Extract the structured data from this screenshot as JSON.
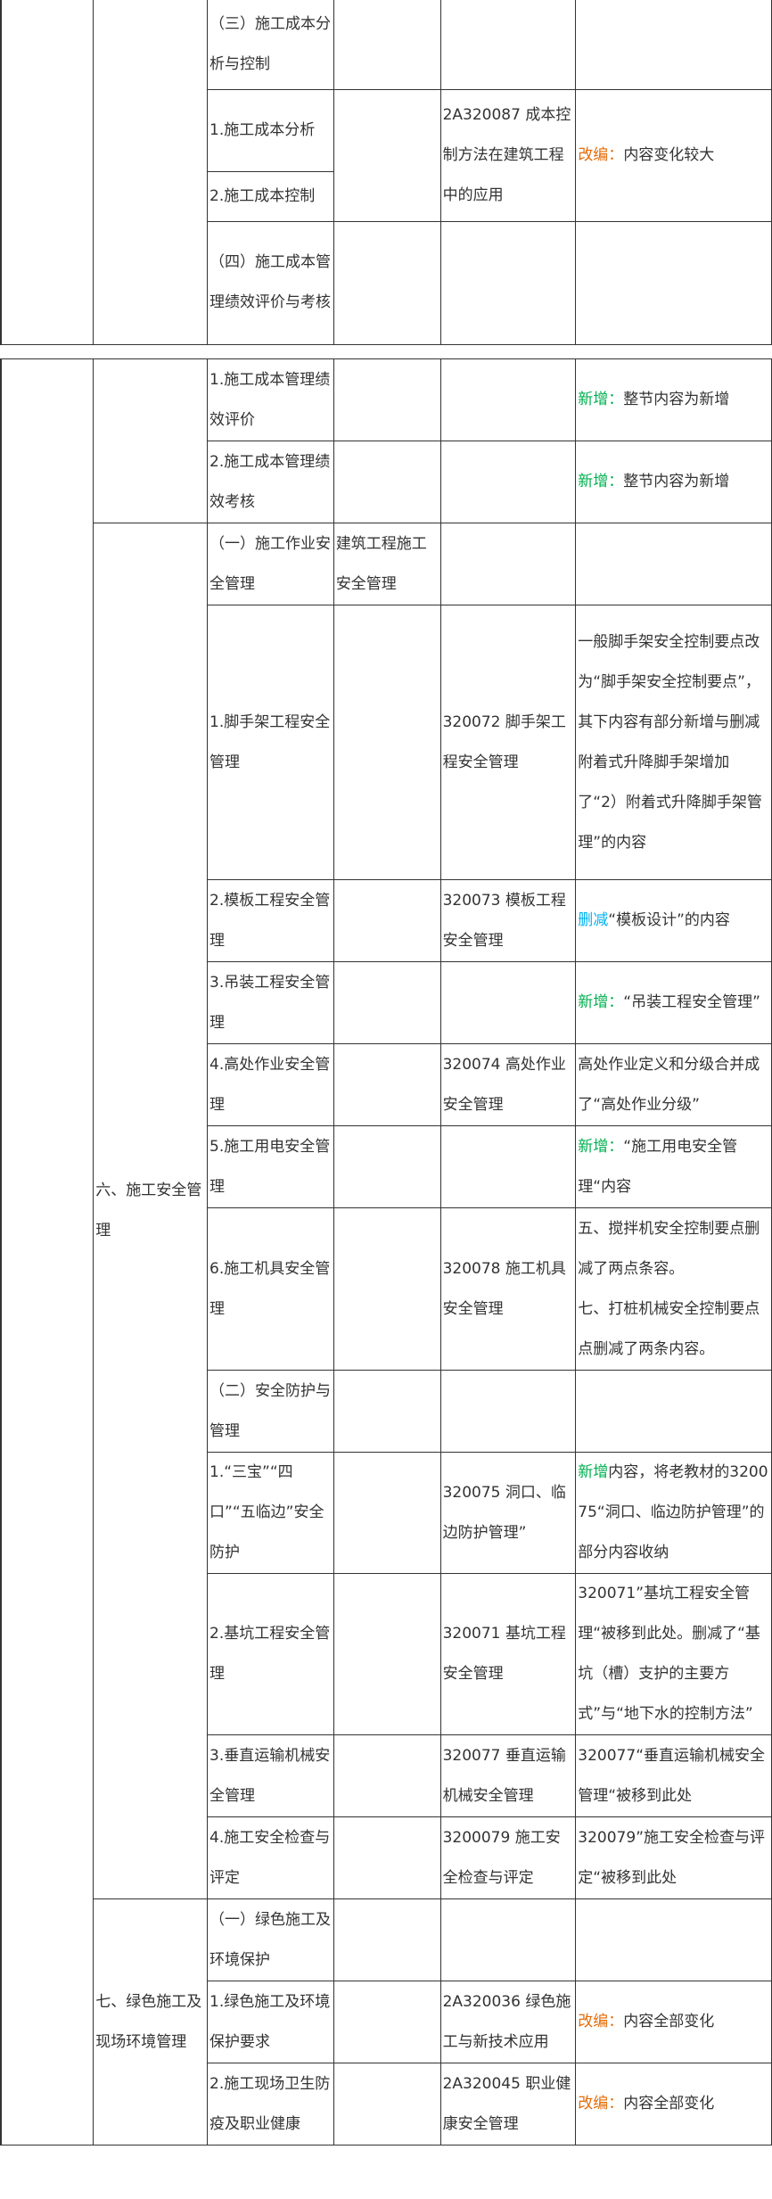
{
  "table1": {
    "rows": [
      {
        "c3": "（三）施工成本分析与控制"
      },
      {
        "c3": "1.施工成本分析",
        "c5": "2A320087 成本控制方法在建筑工程中的应用",
        "c6_tag": "改编：",
        "c6_text": "内容变化较大"
      },
      {
        "c3": "2.施工成本控制"
      },
      {
        "c3": "（四）施工成本管理绩效评价与考核"
      }
    ]
  },
  "table2": {
    "rows": [
      {
        "c3": "1.施工成本管理绩效评价",
        "c6_tag": "新增：",
        "c6_text": "整节内容为新增"
      },
      {
        "c3": "2.施工成本管理绩效考核",
        "c6_tag": "新增：",
        "c6_text": "整节内容为新增"
      },
      {
        "c2": "六、施工安全管理",
        "c3": "（一）施工作业安全管理",
        "c4": "建筑工程施工安全管理"
      },
      {
        "c3": "1.脚手架工程安全管理",
        "c5": "320072 脚手架工程安全管理",
        "c6_text": "一般脚手架安全控制要点改为“脚手架安全控制要点”，其下内容有部分新增与删减",
        "c6_text2": "附着式升降脚手架增加了“2）附着式升降脚手架管理”的内容"
      },
      {
        "c3": "2.模板工程安全管理",
        "c5": "320073 模板工程安全管理",
        "c6_tag": "删减",
        "c6_text": "“模板设计”的内容"
      },
      {
        "c3": "3.吊装工程安全管理",
        "c6_tag": "新增：",
        "c6_text": "“吊装工程安全管理”"
      },
      {
        "c3": "4.高处作业安全管理",
        "c5": "320074 高处作业安全管理",
        "c6_text": "高处作业定义和分级合并成了“高处作业分级”"
      },
      {
        "c3": "5.施工用电安全管理",
        "c6_tag": "新增：",
        "c6_text": "“施工用电安全管理“内容"
      },
      {
        "c3": "6.施工机具安全管理",
        "c5": "320078 施工机具安全管理",
        "c6_text": "五、搅拌机安全控制要点删减了两点条容。",
        "c6_text2": "七、打桩机械安全控制要点点删减了两条内容。"
      },
      {
        "c3": "（二）安全防护与管理"
      },
      {
        "c3": "1.“三宝”“四口”“五临边”安全防护",
        "c5": "320075 洞口、临边防护管理”",
        "c6_tag": "新增",
        "c6_text": "内容，将老教材的320075“洞口、临边防护管理”的部分内容收纳"
      },
      {
        "c3": "2.基坑工程安全管理",
        "c5": "320071 基坑工程安全管理",
        "c6_text": "320071”基坑工程安全管理“被移到此处。删减了“基坑（槽）支护的主要方式”与“地下水的控制方法”"
      },
      {
        "c3": "3.垂直运输机械安全管理",
        "c5": "320077 垂直运输机械安全管理",
        "c6_text": "320077“垂直运输机械安全管理“被移到此处"
      },
      {
        "c3": "4.施工安全检查与评定",
        "c5": "3200079 施工安全检查与评定",
        "c6_text": "320079”施工安全检查与评定“被移到此处"
      },
      {
        "c2": "七、绿色施工及现场环境管理",
        "c3": "（一）绿色施工及环境保护"
      },
      {
        "c3": "1.绿色施工及环境保护要求",
        "c5": "2A320036 绿色施工与新技术应用",
        "c6_tag": "改编：",
        "c6_text": "内容全部变化"
      },
      {
        "c3": "2.施工现场卫生防疫及职业健康",
        "c5": "2A320045 职业健康安全管理",
        "c6_tag": "改编：",
        "c6_text": "内容全部变化"
      }
    ]
  },
  "colors": {
    "change": "#e36c09",
    "new": "#00b050",
    "delete": "#00b0f0",
    "border": "#333333"
  }
}
